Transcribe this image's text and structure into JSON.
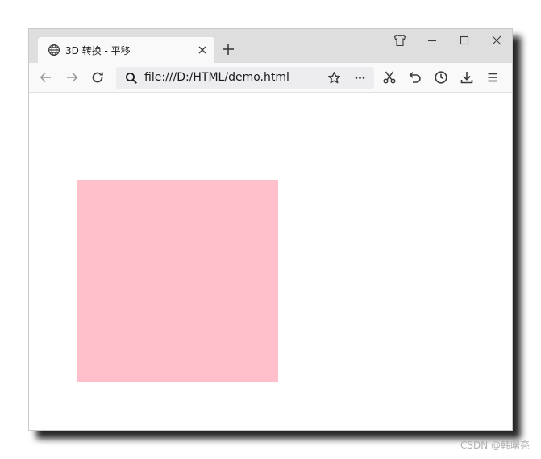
{
  "tab": {
    "title": "3D 转换 - 平移",
    "icon": "globe-icon"
  },
  "addressbar": {
    "url": "file:///D:/HTML/demo.html"
  },
  "page": {
    "box_color": "#FFC0CB"
  },
  "watermark": {
    "text": "CSDN @韩曙亮"
  },
  "colors": {
    "titlebar": "#dedede",
    "toolbar": "#f9f9fa",
    "urlbar": "#ededf0",
    "icon": "#3b3b3b"
  }
}
